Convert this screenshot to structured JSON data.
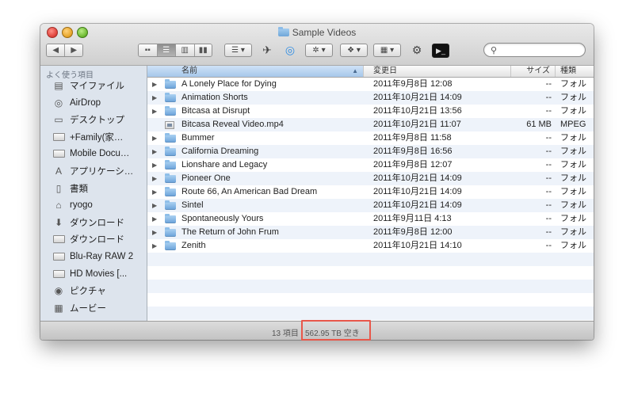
{
  "window": {
    "title": "Sample Videos"
  },
  "toolbar": {
    "back_icon": "chevron-left-icon",
    "forward_icon": "chevron-right-icon",
    "view_modes": [
      "icon-view",
      "list-view",
      "column-view",
      "coverflow-view"
    ],
    "active_view": "list-view",
    "search": {
      "placeholder": "",
      "value": ""
    }
  },
  "sidebar": {
    "section_label": "よく使う項目",
    "items": [
      {
        "label": "マイファイル",
        "icon": "all-my-files-icon"
      },
      {
        "label": "AirDrop",
        "icon": "airdrop-icon"
      },
      {
        "label": "デスクトップ",
        "icon": "desktop-icon"
      },
      {
        "label": "+Family(家…",
        "icon": "folder-icon"
      },
      {
        "label": "Mobile Docu…",
        "icon": "folder-icon"
      },
      {
        "label": "アプリケーシ…",
        "icon": "applications-icon"
      },
      {
        "label": "書類",
        "icon": "documents-icon"
      },
      {
        "label": "ryogo",
        "icon": "home-icon"
      },
      {
        "label": "ダウンロード",
        "icon": "downloads-icon"
      },
      {
        "label": "ダウンロード",
        "icon": "folder-icon"
      },
      {
        "label": "Blu-Ray RAW 2",
        "icon": "folder-icon"
      },
      {
        "label": "HD Movies [...",
        "icon": "folder-icon"
      },
      {
        "label": "ピクチャ",
        "icon": "pictures-icon"
      },
      {
        "label": "ムービー",
        "icon": "movies-icon"
      }
    ]
  },
  "columns": {
    "name": "名前",
    "date": "変更日",
    "size": "サイズ",
    "kind": "種類"
  },
  "files": [
    {
      "name": "A Lonely Place for Dying",
      "date": "2011年9月8日 12:08",
      "size": "--",
      "kind": "フォル",
      "type": "folder"
    },
    {
      "name": "Animation Shorts",
      "date": "2011年10月21日 14:09",
      "size": "--",
      "kind": "フォル",
      "type": "folder"
    },
    {
      "name": "Bitcasa at Disrupt",
      "date": "2011年10月21日 13:56",
      "size": "--",
      "kind": "フォル",
      "type": "folder"
    },
    {
      "name": "Bitcasa Reveal Video.mp4",
      "date": "2011年10月21日 11:07",
      "size": "61 MB",
      "kind": "MPEG",
      "type": "video"
    },
    {
      "name": "Bummer",
      "date": "2011年9月8日 11:58",
      "size": "--",
      "kind": "フォル",
      "type": "folder"
    },
    {
      "name": "California Dreaming",
      "date": "2011年9月8日 16:56",
      "size": "--",
      "kind": "フォル",
      "type": "folder"
    },
    {
      "name": "Lionshare and Legacy",
      "date": "2011年9月8日 12:07",
      "size": "--",
      "kind": "フォル",
      "type": "folder"
    },
    {
      "name": "Pioneer One",
      "date": "2011年10月21日 14:09",
      "size": "--",
      "kind": "フォル",
      "type": "folder"
    },
    {
      "name": "Route 66, An American Bad Dream",
      "date": "2011年10月21日 14:09",
      "size": "--",
      "kind": "フォル",
      "type": "folder"
    },
    {
      "name": "Sintel",
      "date": "2011年10月21日 14:09",
      "size": "--",
      "kind": "フォル",
      "type": "folder"
    },
    {
      "name": "Spontaneously Yours",
      "date": "2011年9月11日 4:13",
      "size": "--",
      "kind": "フォル",
      "type": "folder"
    },
    {
      "name": "The Return of John Frum",
      "date": "2011年9月8日 12:00",
      "size": "--",
      "kind": "フォル",
      "type": "folder"
    },
    {
      "name": "Zenith",
      "date": "2011年10月21日 14:10",
      "size": "--",
      "kind": "フォル",
      "type": "folder"
    }
  ],
  "status": {
    "count": "13 項目",
    "free_space": "562.95 TB 空き"
  },
  "colors": {
    "highlight": "#e8574a",
    "sidebar_bg": "#dde4ed",
    "row_alt": "#eef3fa",
    "header_selected": "#a6c7ea"
  }
}
